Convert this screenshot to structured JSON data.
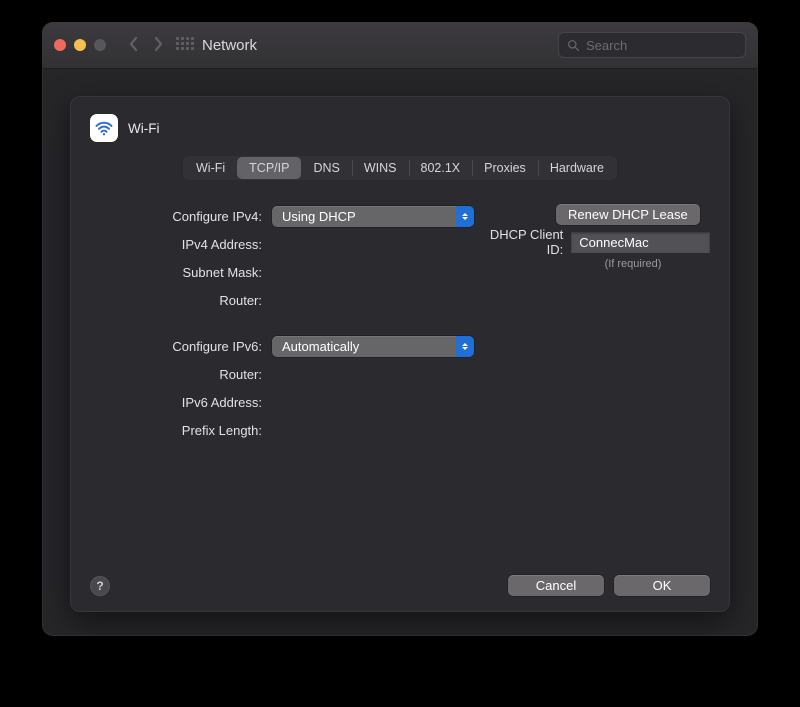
{
  "titlebar": {
    "title": "Network",
    "search_placeholder": "Search"
  },
  "sheet": {
    "header": "Wi-Fi"
  },
  "tabs": [
    {
      "label": "Wi-Fi"
    },
    {
      "label": "TCP/IP"
    },
    {
      "label": "DNS"
    },
    {
      "label": "WINS"
    },
    {
      "label": "802.1X"
    },
    {
      "label": "Proxies"
    },
    {
      "label": "Hardware"
    }
  ],
  "tabs_selected_index": 1,
  "form": {
    "configure_ipv4": {
      "label": "Configure IPv4:",
      "value": "Using DHCP"
    },
    "ipv4_address": {
      "label": "IPv4 Address:",
      "value": ""
    },
    "subnet_mask": {
      "label": "Subnet Mask:",
      "value": ""
    },
    "router_v4": {
      "label": "Router:",
      "value": ""
    },
    "configure_ipv6": {
      "label": "Configure IPv6:",
      "value": "Automatically"
    },
    "router_v6": {
      "label": "Router:",
      "value": ""
    },
    "ipv6_address": {
      "label": "IPv6 Address:",
      "value": ""
    },
    "prefix_length": {
      "label": "Prefix Length:",
      "value": ""
    }
  },
  "dhcp": {
    "renew_label": "Renew DHCP Lease",
    "client_id_label": "DHCP Client ID:",
    "client_id_value": "ConnecMac",
    "hint": "(If required)"
  },
  "footer": {
    "help": "?",
    "cancel": "Cancel",
    "ok": "OK"
  }
}
